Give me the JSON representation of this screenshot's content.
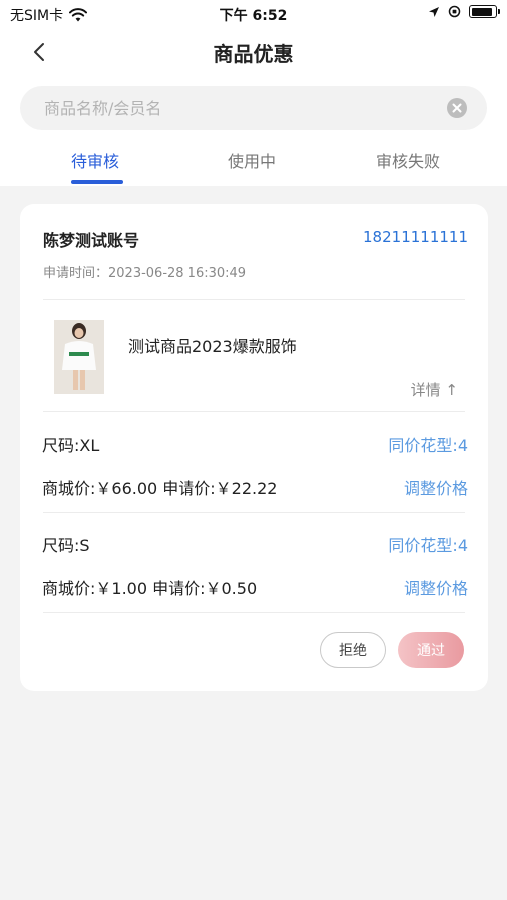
{
  "status_bar": {
    "carrier": "无SIM卡",
    "time": "下午 6:52",
    "battery_level": 0.9
  },
  "nav": {
    "title": "商品优惠",
    "back_icon": "chevron-left-icon"
  },
  "search": {
    "placeholder": "商品名称/会员名",
    "value": "",
    "clear_icon": "clear-circle-icon"
  },
  "tabs": [
    {
      "label": "待审核",
      "active": true
    },
    {
      "label": "使用中",
      "active": false
    },
    {
      "label": "审核失败",
      "active": false
    }
  ],
  "colors": {
    "accent": "#2a5ed9",
    "link": "#5b9ae0",
    "approve_gradient_start": "#f4c3c6",
    "approve_gradient_end": "#e99aa0"
  },
  "card": {
    "account_name": "陈梦测试账号",
    "phone": "18211111111",
    "apply_time": "申请时间：2023-06-28 16:30:49",
    "product": {
      "name": "测试商品2023爆款服饰",
      "detail_label": "详情 ↑"
    },
    "sizes": [
      {
        "size": "尺码:XL",
        "same_price": "同价花型:4",
        "price_line": "商城价:￥66.00 申请价:￥22.22",
        "adjust_label": "调整价格"
      },
      {
        "size": "尺码:S",
        "same_price": "同价花型:4",
        "price_line": "商城价:￥1.00 申请价:￥0.50",
        "adjust_label": "调整价格"
      }
    ],
    "actions": {
      "reject": "拒绝",
      "approve": "通过"
    }
  }
}
